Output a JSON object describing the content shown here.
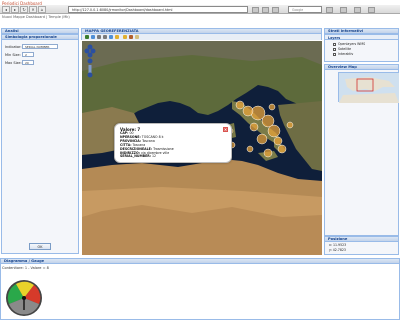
{
  "app": {
    "title": "Periodici Dashboard",
    "subtitle": "Nuovi Mappe Dashboard | Temple (Mk)"
  },
  "browser": {
    "url": "http://127.0.0.1:8080/jrmonitor/Dashboard/dashboard.html",
    "search_placeholder": "Google",
    "colors": {
      "chrome": "#d8d8d8",
      "accent": "#c44a2e"
    }
  },
  "left_panel": {
    "title": "Analisi",
    "subtitle": "Simbologia proporzionale",
    "indicator_label": "Indicator:",
    "indicator_value": "SERIAL NUMBER",
    "min_size_label": "Min Size:",
    "min_size_value": "2",
    "max_size_label": "Max Size:",
    "max_size_value": "20",
    "ok_label": "OK"
  },
  "map": {
    "title": "MAPPA GEOREFERENZIATA",
    "toolbar_icons": [
      "zoom-in-icon",
      "zoom-out-icon",
      "pan-icon",
      "zoom-box-icon",
      "back-icon",
      "forward-icon",
      "info-icon",
      "measure-icon"
    ],
    "marker_color": "#e8a33a",
    "popup": {
      "title": "Valore: 7",
      "rows": [
        {
          "key": "CAP:",
          "value": "00"
        },
        {
          "key": "NPERSONE:",
          "value": "TOSCANO 8 k"
        },
        {
          "key": "PROVINCIA:",
          "value": "Toscana"
        },
        {
          "key": "CITTA:",
          "value": "Toscana"
        },
        {
          "key": "DESCRIZIONEALE:",
          "value": "Trasmissione"
        },
        {
          "key": "INDIRIZZO:",
          "value": "via dicembre ville"
        },
        {
          "key": "SERIAL_NUMBER:",
          "value": "12"
        }
      ]
    }
  },
  "right_panel": {
    "title": "Strati Informativi",
    "legend_title": "Layers",
    "layers": [
      {
        "label": "Openlayers WMS"
      },
      {
        "label": "Satellite"
      },
      {
        "label": "Interaktiv"
      }
    ],
    "overview_title": "Overview Map",
    "position_title": "Posizione",
    "position_x": "x: 11.9523",
    "position_y": "y: 42.7823"
  },
  "bottom_panel": {
    "title": "Diagramma / Gauge",
    "caption": "Contenitore: 1 - Valore = 8",
    "gauge_colors": [
      "#2aa84a",
      "#e8d22a",
      "#d63a2a"
    ]
  }
}
